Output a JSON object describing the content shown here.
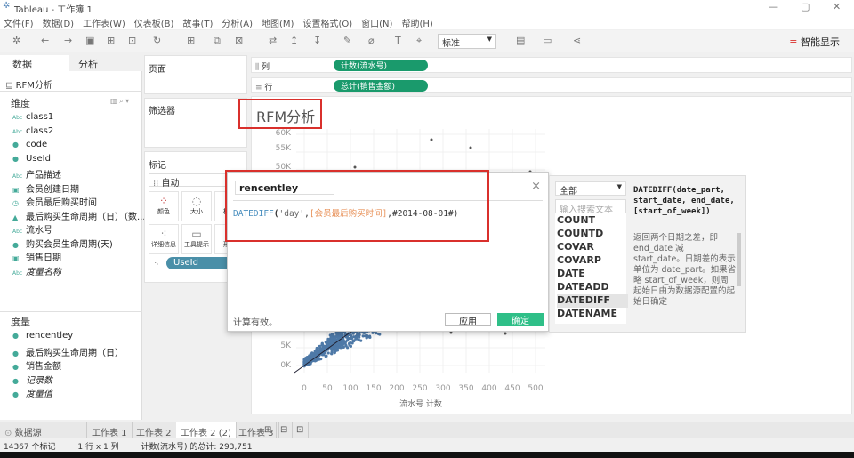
{
  "window": {
    "title": "Tableau - 工作簿 1",
    "minimize": "—",
    "restore": "▢",
    "close": "✕"
  },
  "menu": [
    "文件(F)",
    "数据(D)",
    "工作表(W)",
    "仪表板(B)",
    "故事(T)",
    "分析(A)",
    "地图(M)",
    "设置格式(O)",
    "窗口(N)",
    "帮助(H)"
  ],
  "toolbar": {
    "fit_select": "标准",
    "smart_show": "智能显示",
    "icons": [
      "tableau-logo",
      "undo",
      "redo",
      "save",
      "new-datasource",
      "pause-updates",
      "refresh",
      "new-sheet",
      "duplicate-sheet",
      "clear-sheet",
      "swap",
      "sort-asc",
      "sort-desc",
      "highlight",
      "group",
      "labels",
      "fix-axes",
      "fit",
      "presentation",
      "share"
    ]
  },
  "left": {
    "tab_data": "数据",
    "tab_analysis": "分析",
    "datasource": "RFM分析",
    "dimensions_header": "维度",
    "dimensions": [
      {
        "label": "class1",
        "icon": "Abc"
      },
      {
        "label": "class2",
        "icon": "Abc"
      },
      {
        "label": "code",
        "icon": "#"
      },
      {
        "label": "UseId",
        "icon": "#"
      },
      {
        "label": "产品描述",
        "icon": "Abc"
      },
      {
        "label": "会员创建日期",
        "icon": "date"
      },
      {
        "label": "会员最后购买时间",
        "icon": "datetime"
      },
      {
        "label": "最后购买生命周期（日）（数...",
        "icon": "bin"
      },
      {
        "label": "流水号",
        "icon": "Abc"
      },
      {
        "label": "购买会员生命周期(天)",
        "icon": "#"
      },
      {
        "label": "销售日期",
        "icon": "date"
      },
      {
        "label": "度量名称",
        "icon": "Abc",
        "italic": true
      }
    ],
    "measures_header": "度量",
    "measures": [
      {
        "label": "rencentley"
      },
      {
        "label": "最后购买生命周期（日）"
      },
      {
        "label": "销售金额"
      },
      {
        "label": "记录数",
        "italic": true
      },
      {
        "label": "度量值",
        "italic": true
      }
    ]
  },
  "cards": {
    "pages": "页面",
    "filters": "筛选器",
    "marks": "标记",
    "mark_type": "自动",
    "mark_buttons": [
      "颜色",
      "大小",
      "标签",
      "详细信息",
      "工具提示",
      "形状"
    ],
    "detail_pill": "UseId"
  },
  "shelves": {
    "columns_label": "列",
    "columns_pill": "计数(流水号)",
    "rows_label": "行",
    "rows_pill": "总计(销售金额)"
  },
  "view": {
    "title": "RFM分析",
    "y_ticks": [
      "60K",
      "55K",
      "50K",
      "5K",
      "0K"
    ],
    "x_ticks": [
      "0",
      "50",
      "100",
      "150",
      "200",
      "250",
      "300",
      "350",
      "400",
      "450",
      "500"
    ],
    "x_label": "流水号 计数",
    "mark_color": "#4e79a7"
  },
  "calc_dialog": {
    "name": "rencentley",
    "formula_fn": "DATEDIFF",
    "formula_open": "(",
    "formula_arg1": "'day'",
    "formula_comma1": ",",
    "formula_field": "[会员最后购买时间]",
    "formula_rest": ",#2014-08-01#)",
    "status": "计算有效。",
    "apply": "应用",
    "ok": "确定",
    "close": "×"
  },
  "function_panel": {
    "category": "全部",
    "search_placeholder": "输入搜索文本",
    "functions": [
      "COUNT",
      "COUNTD",
      "COVAR",
      "COVARP",
      "DATE",
      "DATEADD",
      "DATEDIFF",
      "DATENAME"
    ],
    "selected": "DATEDIFF",
    "signature": "DATEDIFF(date_part, start_date, end_date, [start_of_week])",
    "description": "返回两个日期之差，即 end_date 减 start_date。日期差的表示单位为 date_part。如果省略 start_of_week，则周起始日由为数据源配置的起始日确定"
  },
  "bottom_tabs": {
    "datasource": "数据源",
    "sheets": [
      "工作表 1",
      "工作表 2",
      "工作表 2 (2)",
      "工作表 3"
    ],
    "active": "工作表 2 (2)"
  },
  "status": {
    "marks": "14367 个标记",
    "dims": "1 行 x 1 列",
    "sum": "计数(流水号) 的总计: 293,751"
  },
  "colors": {
    "accent_green": "#1a9a6c",
    "highlight_red": "#d9302c",
    "field_blue": "#4a8fa8"
  }
}
